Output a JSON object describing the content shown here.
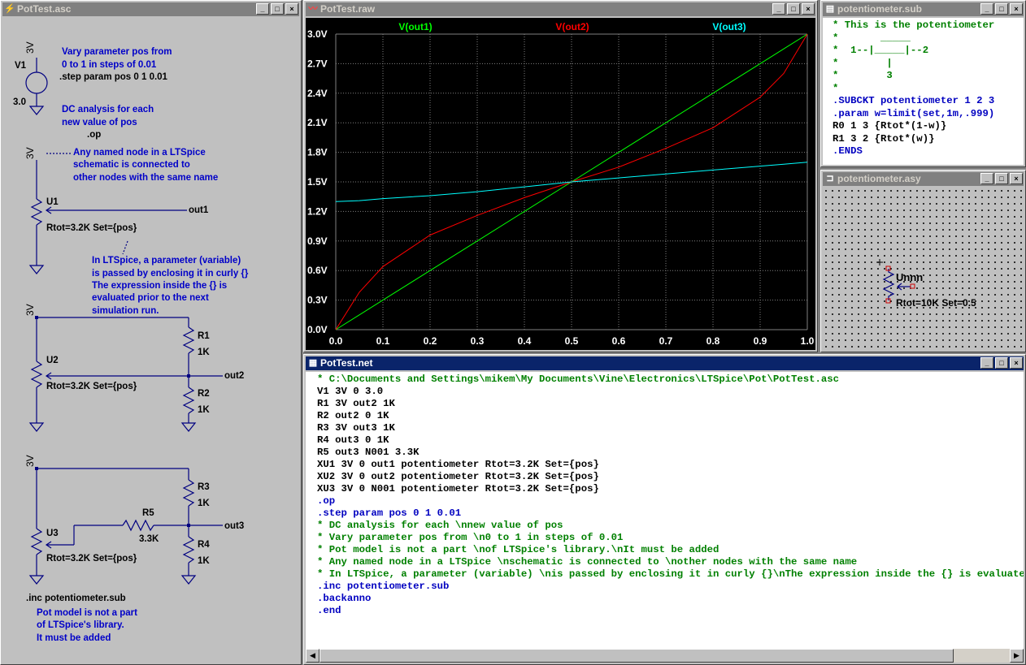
{
  "schematic_window": {
    "title": "PotTest.asc",
    "comment_step": [
      "Vary parameter pos from",
      "0 to 1 in steps of 0.01"
    ],
    "directive_step": ".step param pos 0 1 0.01",
    "source_name": "V1",
    "source_node": "3V",
    "source_value": "3.0",
    "comment_dc": [
      "DC analysis for each",
      "new value of pos"
    ],
    "directive_op": ".op",
    "comment_node": [
      "Any named node in a LTSpice",
      "schematic is connected to",
      "other nodes with the same name"
    ],
    "comment_param": [
      "In LTSpice, a parameter (variable)",
      "is passed by enclosing it in curly {}",
      "The expression inside the {} is",
      "evaluated prior to the next",
      "simulation run."
    ],
    "node_3v": "3V",
    "u1": "U1",
    "u2": "U2",
    "u3": "U3",
    "pot_params": "Rtot=3.2K Set={pos}",
    "out1": "out1",
    "out2": "out2",
    "out3": "out3",
    "r1": "R1",
    "r2": "R2",
    "r3": "R3",
    "r4": "R4",
    "r5": "R5",
    "r1k": "1K",
    "r33k": "3.3K",
    "directive_inc": ".inc potentiometer.sub",
    "comment_inc": [
      "Pot model is not a part",
      "of LTSpice's library.",
      "It must be added"
    ]
  },
  "plot_window": {
    "title": "PotTest.raw",
    "colors": {
      "bg": "#000000",
      "grid": "#808080",
      "out1": "#00ff00",
      "out2": "#ff0000",
      "out3": "#00ffff"
    }
  },
  "chart_data": {
    "type": "line",
    "xlim": [
      0,
      1
    ],
    "ylim": [
      0,
      3.0
    ],
    "x_ticks": [
      "0.0",
      "0.1",
      "0.2",
      "0.3",
      "0.4",
      "0.5",
      "0.6",
      "0.7",
      "0.8",
      "0.9",
      "1.0"
    ],
    "y_ticks": [
      "0.0V",
      "0.3V",
      "0.6V",
      "0.9V",
      "1.2V",
      "1.5V",
      "1.8V",
      "2.1V",
      "2.4V",
      "2.7V",
      "3.0V"
    ],
    "grid": true,
    "legend_placement": "top",
    "x": [
      0,
      0.05,
      0.1,
      0.2,
      0.3,
      0.4,
      0.5,
      0.6,
      0.7,
      0.8,
      0.9,
      0.95,
      1.0
    ],
    "series": [
      {
        "name": "V(out1)",
        "values": [
          0,
          0.15,
          0.3,
          0.6,
          0.9,
          1.2,
          1.5,
          1.8,
          2.1,
          2.4,
          2.7,
          2.85,
          3.0
        ]
      },
      {
        "name": "V(out2)",
        "values": [
          0,
          0.38,
          0.64,
          0.96,
          1.16,
          1.34,
          1.5,
          1.65,
          1.84,
          2.05,
          2.36,
          2.6,
          3.0
        ]
      },
      {
        "name": "V(out3)",
        "values": [
          1.3,
          1.31,
          1.33,
          1.36,
          1.4,
          1.45,
          1.5,
          1.54,
          1.58,
          1.62,
          1.66,
          1.68,
          1.7
        ]
      }
    ]
  },
  "sub_window": {
    "title": "potentiometer.sub",
    "lines": [
      {
        "text": "* This is the potentiometer",
        "color": "#008000"
      },
      {
        "text": "*       _____",
        "color": "#008000"
      },
      {
        "text": "*  1--|_____|--2",
        "color": "#008000"
      },
      {
        "text": "*        |",
        "color": "#008000"
      },
      {
        "text": "*        3",
        "color": "#008000"
      },
      {
        "text": "*",
        "color": "#008000"
      },
      {
        "text": ".SUBCKT potentiometer 1 2 3",
        "color": "#0000c0"
      },
      {
        "text": ".param w=limit(set,1m,.999)",
        "color": "#0000c0"
      },
      {
        "text": "R0 1 3 {Rtot*(1-w)}",
        "color": "#000000"
      },
      {
        "text": "R1 3 2 {Rtot*(w)}",
        "color": "#000000"
      },
      {
        "text": ".ENDS",
        "color": "#0000c0"
      }
    ]
  },
  "asy_window": {
    "title": "potentiometer.asy",
    "inst": "Unnn",
    "value": "Rtot=10K Set=0.5"
  },
  "net_window": {
    "title": "PotTest.net",
    "lines": [
      {
        "text": "* C:\\Documents and Settings\\mikem\\My Documents\\Vine\\Electronics\\LTSpice\\Pot\\PotTest.asc",
        "color": "#008000"
      },
      {
        "text": "V1 3V 0 3.0",
        "color": "#000000"
      },
      {
        "text": "R1 3V out2 1K",
        "color": "#000000"
      },
      {
        "text": "R2 out2 0 1K",
        "color": "#000000"
      },
      {
        "text": "R3 3V out3 1K",
        "color": "#000000"
      },
      {
        "text": "R4 out3 0 1K",
        "color": "#000000"
      },
      {
        "text": "R5 out3 N001 3.3K",
        "color": "#000000"
      },
      {
        "text": "XU1 3V 0 out1 potentiometer Rtot=3.2K Set={pos}",
        "color": "#000000"
      },
      {
        "text": "XU2 3V 0 out2 potentiometer Rtot=3.2K Set={pos}",
        "color": "#000000"
      },
      {
        "text": "XU3 3V 0 N001 potentiometer Rtot=3.2K Set={pos}",
        "color": "#000000"
      },
      {
        "text": ".op",
        "color": "#0000c0"
      },
      {
        "text": ".step param pos 0 1 0.01",
        "color": "#0000c0"
      },
      {
        "text": "* DC analysis for each \\nnew value of pos",
        "color": "#008000"
      },
      {
        "text": "* Vary parameter pos from \\n0 to 1 in steps of 0.01",
        "color": "#008000"
      },
      {
        "text": "* Pot model is not a part \\nof LTSpice's library.\\nIt must be added",
        "color": "#008000"
      },
      {
        "text": "* Any named node in a LTSpice \\nschematic is connected to \\nother nodes with the same name",
        "color": "#008000"
      },
      {
        "text": "* In LTSpice, a parameter (variable) \\nis passed by enclosing it in curly {}\\nThe expression inside the {} is evaluated prior to the next simulation run.",
        "color": "#008000"
      },
      {
        "text": ".inc potentiometer.sub",
        "color": "#0000c0"
      },
      {
        "text": ".backanno",
        "color": "#0000c0"
      },
      {
        "text": ".end",
        "color": "#0000c0"
      }
    ]
  }
}
